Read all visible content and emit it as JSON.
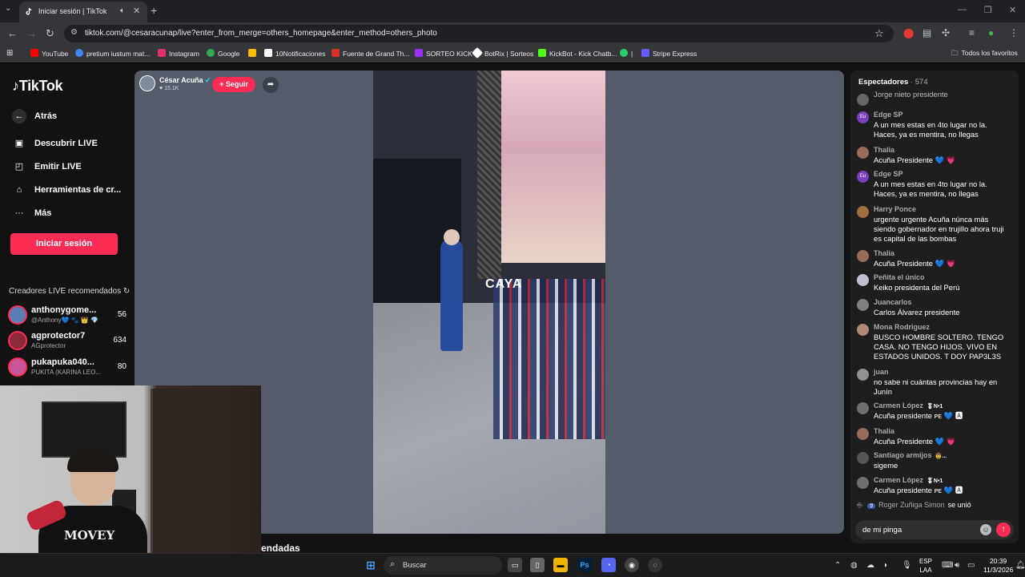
{
  "browser": {
    "tab_title": "Iniciar sesión | TikTok",
    "url": "tiktok.com/@cesaracunap/live?enter_from_merge=others_homepage&enter_method=others_photo",
    "bookmarks": [
      {
        "label": "YouTube",
        "color": "#ff0000"
      },
      {
        "label": "pretium iustum mat...",
        "color": "#4285f4"
      },
      {
        "label": "Instagram",
        "color": "#e1306c"
      },
      {
        "label": "Google",
        "color": "#34a853"
      },
      {
        "label": "",
        "color": "#fbbc05"
      },
      {
        "label": "10Notificaciones",
        "color": "#ffffff"
      },
      {
        "label": "Fuente de Grand Th...",
        "color": "#d93025"
      },
      {
        "label": "SORTEO KICK",
        "color": "#9b30ff"
      },
      {
        "label": "BotRix | Sorteos",
        "color": "#ffffff"
      },
      {
        "label": "KickBot - Kick Chatb...",
        "color": "#53fc18"
      },
      {
        "label": "|",
        "color": "#25d366"
      },
      {
        "label": "Stripe Express",
        "color": "#635bff"
      }
    ],
    "all_bookmarks": "Todos los favoritos"
  },
  "sidebar": {
    "logo": "TikTok",
    "back": "Atrás",
    "nav": [
      {
        "icon": "▣",
        "label": "Descubrir LIVE"
      },
      {
        "icon": "◰",
        "label": "Emitir LIVE"
      },
      {
        "icon": "⌂",
        "label": "Herramientas de cr..."
      },
      {
        "icon": "···",
        "label": "Más"
      }
    ],
    "login": "Iniciar sesión",
    "reco_title": "Creadores LIVE recomendados",
    "creators": [
      {
        "name": "anthonygome...",
        "handle": "@Anthony💙 🐾 👑 💎",
        "count": "56",
        "color": "#5a7fb5"
      },
      {
        "name": "agprotector7",
        "handle": "AGprotector",
        "count": "634",
        "color": "#8a2a3a"
      },
      {
        "name": "pukapuka040...",
        "handle": "PUKITA (KARINA LEO...",
        "count": "80",
        "color": "#c9559a"
      }
    ]
  },
  "webcam": {
    "shirt_text": "MOVEY"
  },
  "live": {
    "host_name": "César Acuña",
    "host_likes": "♥ 15.1K",
    "follow": "+ Seguir",
    "video_sign": "CAYA",
    "cut_label": "endadas"
  },
  "chat": {
    "title": "Espectadores",
    "viewers": "· 574",
    "messages": [
      {
        "user": "",
        "text": "Jorge nieto presidente",
        "color": "#666666",
        "av": ""
      },
      {
        "user": "Edge SP",
        "text": "A un mes estas en 4to lugar no la. Haces, ya es mentira, no llegas",
        "color": "#7b3fbf",
        "av": "Eu"
      },
      {
        "user": "Thalia",
        "text": "Acuña Presidente 💙 💗",
        "color": "#9b6b5a",
        "av": ""
      },
      {
        "user": "Edge SP",
        "text": "A un mes estas en 4to lugar no la. Haces, ya es mentira, no llegas",
        "color": "#7b3fbf",
        "av": "Eu"
      },
      {
        "user": "Harry Ponce",
        "text": "urgente urgente Acuña núnca más siendo gobernador en trujillo ahora truji es capital de las bombas",
        "color": "#a07040",
        "av": ""
      },
      {
        "user": "Thalia",
        "text": "Acuña Presidente 💙 💗",
        "color": "#9b6b5a",
        "av": ""
      },
      {
        "user": "Peñita el único",
        "text": "Keiko presidenta del Perú",
        "color": "#c0c0d0",
        "av": ""
      },
      {
        "user": "Juancarlos",
        "text": "Carlos Álvarez presidente",
        "color": "#808080",
        "av": ""
      },
      {
        "user": "Mona Rodriguez",
        "text": "BUSCO HOMBRE SOLTERO. TENGO CASA. NO TENGO HIJOS. VIVO EN ESTADOS UNIDOS. T DOY PAP3L3S",
        "color": "#b08878",
        "av": ""
      },
      {
        "user": "juan",
        "text": "no sabe ni cuántas provincias hay en Junín",
        "color": "#909090",
        "av": ""
      },
      {
        "user": "Carmen López",
        "badge": "🎖N•1",
        "text": "Acuña presidente ᴘᴇ 💙 🅰",
        "color": "#707070",
        "av": ""
      },
      {
        "user": "Thalia",
        "text": "Acuña Presidente 💙 💗",
        "color": "#9b6b5a",
        "av": ""
      },
      {
        "user": "Santiago armijos",
        "badge": "🤠...",
        "text": "sigeme",
        "color": "#555555",
        "av": ""
      },
      {
        "user": "Carmen López",
        "badge": "🎖N•1",
        "text": "Acuña presidente ᴘᴇ 💙 🅰",
        "color": "#707070",
        "av": ""
      }
    ],
    "joined_level": "9",
    "joined_user": "Roger Zuñiga Simon",
    "joined_text": "se unió",
    "input_value": "de mi pinga"
  },
  "taskbar": {
    "search": "Buscar",
    "lang_1": "ESP",
    "lang_2": "LAA",
    "time": "20:39",
    "date": "11/3/2026"
  }
}
